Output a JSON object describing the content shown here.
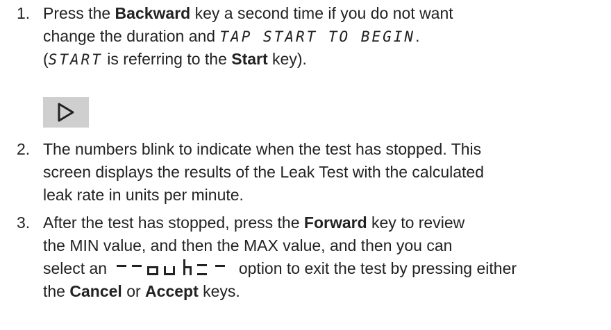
{
  "steps": [
    {
      "number": "1.",
      "line1": {
        "pre": "Press the ",
        "key": "Backward",
        "post": " key a second time if you do not want"
      },
      "line2": {
        "pre": "change the duration and ",
        "seg": "TAP START TO BEGIN",
        "post": "."
      },
      "line3": {
        "pre": "(",
        "seg": "START",
        "mid": " is referring to the ",
        "key": "Start",
        "post": " key)."
      }
    },
    {
      "number": "2.",
      "lines": [
        "The numbers blink to indicate when the test has stopped. This",
        "screen displays the results of the Leak Test with the calculated",
        "leak rate in units per minute."
      ]
    },
    {
      "number": "3.",
      "line1": {
        "pre": "After the test has stopped, press the ",
        "key": "Forward",
        "post": " key to review"
      },
      "line2": "the MIN value, and then the MAX value, and then you can",
      "line3": {
        "pre": "select an ",
        "post": " option to exit the test by pressing either"
      },
      "line4": {
        "pre": "the ",
        "key1": "Cancel",
        "mid": " or ",
        "key2": "Accept",
        "post": " keys."
      }
    }
  ],
  "start_key_icon": "play-triangle-icon",
  "colors": {
    "text": "#222222",
    "key_bg": "#cfcfcf"
  }
}
